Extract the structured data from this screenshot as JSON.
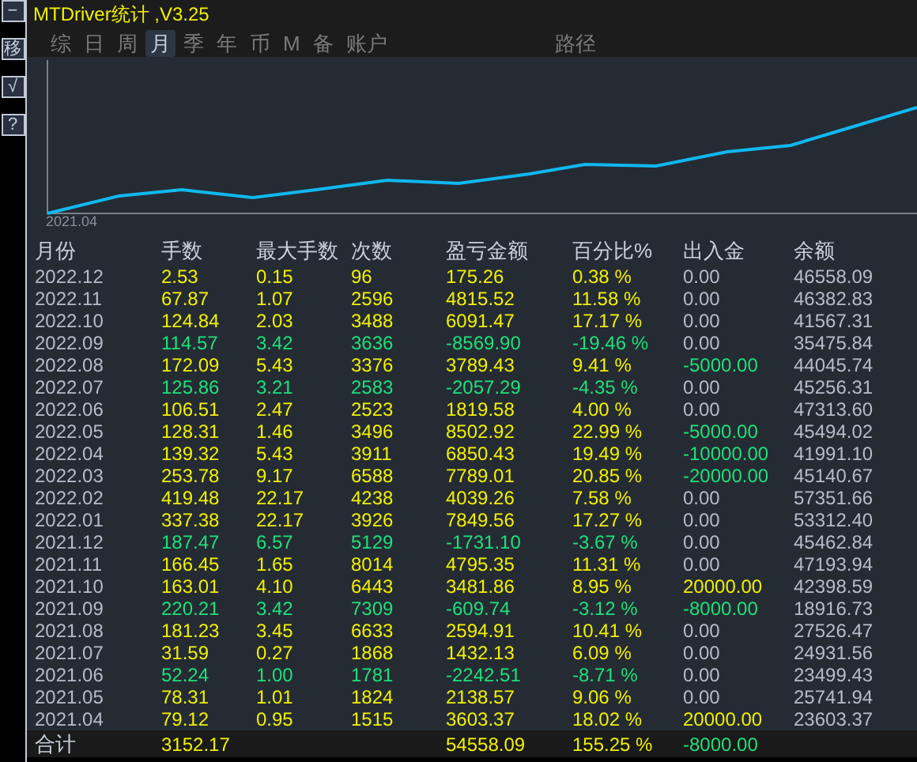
{
  "side_buttons": [
    "−",
    "移",
    "√",
    "?"
  ],
  "title": "MTDriver统计 ,V3.25",
  "tabs": [
    {
      "label": "综",
      "selected": false
    },
    {
      "label": "日",
      "selected": false
    },
    {
      "label": "周",
      "selected": false
    },
    {
      "label": "月",
      "selected": true
    },
    {
      "label": "季",
      "selected": false
    },
    {
      "label": "年",
      "selected": false
    },
    {
      "label": "币",
      "selected": false
    },
    {
      "label": "M",
      "selected": false
    },
    {
      "label": "备",
      "selected": false
    },
    {
      "label": "账户",
      "selected": false
    }
  ],
  "path_button": "路径",
  "chart": {
    "start_label": "2021.04"
  },
  "table": {
    "columns": [
      "月份",
      "手数",
      "最大手数",
      "次数",
      "盈亏金额",
      "百分比%",
      "出入金",
      "余额"
    ],
    "rows": [
      {
        "cells": [
          "2022.12",
          "2.53",
          "0.15",
          "96",
          "175.26",
          "0.38 %",
          "0.00",
          "46558.09"
        ],
        "loss": false,
        "inflow": false,
        "outflow": false
      },
      {
        "cells": [
          "2022.11",
          "67.87",
          "1.07",
          "2596",
          "4815.52",
          "11.58 %",
          "0.00",
          "46382.83"
        ],
        "loss": false,
        "inflow": false,
        "outflow": false
      },
      {
        "cells": [
          "2022.10",
          "124.84",
          "2.03",
          "3488",
          "6091.47",
          "17.17 %",
          "0.00",
          "41567.31"
        ],
        "loss": false,
        "inflow": false,
        "outflow": false
      },
      {
        "cells": [
          "2022.09",
          "114.57",
          "3.42",
          "3636",
          "-8569.90",
          "-19.46 %",
          "0.00",
          "35475.84"
        ],
        "loss": true,
        "inflow": false,
        "outflow": false
      },
      {
        "cells": [
          "2022.08",
          "172.09",
          "5.43",
          "3376",
          "3789.43",
          "9.41 %",
          "-5000.00",
          "44045.74"
        ],
        "loss": false,
        "inflow": false,
        "outflow": true
      },
      {
        "cells": [
          "2022.07",
          "125.86",
          "3.21",
          "2583",
          "-2057.29",
          "-4.35 %",
          "0.00",
          "45256.31"
        ],
        "loss": true,
        "inflow": false,
        "outflow": false
      },
      {
        "cells": [
          "2022.06",
          "106.51",
          "2.47",
          "2523",
          "1819.58",
          "4.00 %",
          "0.00",
          "47313.60"
        ],
        "loss": false,
        "inflow": false,
        "outflow": false
      },
      {
        "cells": [
          "2022.05",
          "128.31",
          "1.46",
          "3496",
          "8502.92",
          "22.99 %",
          "-5000.00",
          "45494.02"
        ],
        "loss": false,
        "inflow": false,
        "outflow": true
      },
      {
        "cells": [
          "2022.04",
          "139.32",
          "5.43",
          "3911",
          "6850.43",
          "19.49 %",
          "-10000.00",
          "41991.10"
        ],
        "loss": false,
        "inflow": false,
        "outflow": true
      },
      {
        "cells": [
          "2022.03",
          "253.78",
          "9.17",
          "6588",
          "7789.01",
          "20.85 %",
          "-20000.00",
          "45140.67"
        ],
        "loss": false,
        "inflow": false,
        "outflow": true
      },
      {
        "cells": [
          "2022.02",
          "419.48",
          "22.17",
          "4238",
          "4039.26",
          "7.58 %",
          "0.00",
          "57351.66"
        ],
        "loss": false,
        "inflow": false,
        "outflow": false
      },
      {
        "cells": [
          "2022.01",
          "337.38",
          "22.17",
          "3926",
          "7849.56",
          "17.27 %",
          "0.00",
          "53312.40"
        ],
        "loss": false,
        "inflow": false,
        "outflow": false
      },
      {
        "cells": [
          "2021.12",
          "187.47",
          "6.57",
          "5129",
          "-1731.10",
          "-3.67 %",
          "0.00",
          "45462.84"
        ],
        "loss": true,
        "inflow": false,
        "outflow": false
      },
      {
        "cells": [
          "2021.11",
          "166.45",
          "1.65",
          "8014",
          "4795.35",
          "11.31 %",
          "0.00",
          "47193.94"
        ],
        "loss": false,
        "inflow": false,
        "outflow": false
      },
      {
        "cells": [
          "2021.10",
          "163.01",
          "4.10",
          "6443",
          "3481.86",
          "8.95 %",
          "20000.00",
          "42398.59"
        ],
        "loss": false,
        "inflow": true,
        "outflow": false
      },
      {
        "cells": [
          "2021.09",
          "220.21",
          "3.42",
          "7309",
          "-609.74",
          "-3.12 %",
          "-8000.00",
          "18916.73"
        ],
        "loss": true,
        "inflow": false,
        "outflow": true
      },
      {
        "cells": [
          "2021.08",
          "181.23",
          "3.45",
          "6633",
          "2594.91",
          "10.41 %",
          "0.00",
          "27526.47"
        ],
        "loss": false,
        "inflow": false,
        "outflow": false
      },
      {
        "cells": [
          "2021.07",
          "31.59",
          "0.27",
          "1868",
          "1432.13",
          "6.09 %",
          "0.00",
          "24931.56"
        ],
        "loss": false,
        "inflow": false,
        "outflow": false
      },
      {
        "cells": [
          "2021.06",
          "52.24",
          "1.00",
          "1781",
          "-2242.51",
          "-8.71 %",
          "0.00",
          "23499.43"
        ],
        "loss": true,
        "inflow": false,
        "outflow": false
      },
      {
        "cells": [
          "2021.05",
          "78.31",
          "1.01",
          "1824",
          "2138.57",
          "9.06 %",
          "0.00",
          "25741.94"
        ],
        "loss": false,
        "inflow": false,
        "outflow": false
      },
      {
        "cells": [
          "2021.04",
          "79.12",
          "0.95",
          "1515",
          "3603.37",
          "18.02 %",
          "20000.00",
          "23603.37"
        ],
        "loss": false,
        "inflow": true,
        "outflow": false
      }
    ],
    "total": {
      "label": "合计",
      "lots": "3152.17",
      "profit": "54558.09",
      "percent": "155.25 %",
      "transfer": "-8000.00",
      "outflow": true
    }
  }
}
